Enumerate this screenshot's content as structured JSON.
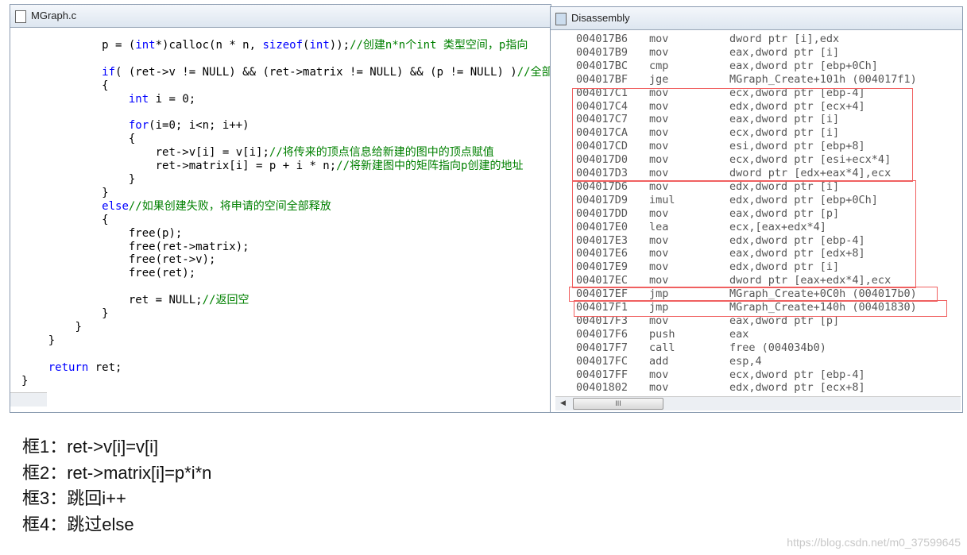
{
  "code_window": {
    "title": "MGraph.c",
    "icon": "c-file-icon",
    "lines": [
      {
        "indent": 12,
        "segs": [
          {
            "t": "p = (",
            "c": "tx"
          },
          {
            "t": "int",
            "c": "kw"
          },
          {
            "t": "*)calloc(n * n, ",
            "c": "tx"
          },
          {
            "t": "sizeof",
            "c": "kw"
          },
          {
            "t": "(",
            "c": "tx"
          },
          {
            "t": "int",
            "c": "kw"
          },
          {
            "t": "));",
            "c": "tx"
          },
          {
            "t": "//创建n*n个int 类型空间，p指向",
            "c": "cm"
          }
        ]
      },
      null,
      {
        "indent": 12,
        "segs": [
          {
            "t": "if",
            "c": "kw"
          },
          {
            "t": "( (ret->v != NULL) && (ret->matrix != NULL) && (p != NULL) )",
            "c": "tx"
          },
          {
            "t": "//全部",
            "c": "cm"
          }
        ]
      },
      {
        "indent": 12,
        "segs": [
          {
            "t": "{",
            "c": "tx"
          }
        ]
      },
      {
        "indent": 16,
        "segs": [
          {
            "t": "int",
            "c": "kw"
          },
          {
            "t": " i = 0;",
            "c": "tx"
          }
        ]
      },
      null,
      {
        "indent": 16,
        "segs": [
          {
            "t": "for",
            "c": "kw"
          },
          {
            "t": "(i=0; i<n; i++)",
            "c": "tx"
          }
        ]
      },
      {
        "indent": 16,
        "segs": [
          {
            "t": "{",
            "c": "tx"
          }
        ]
      },
      {
        "indent": 20,
        "segs": [
          {
            "t": "ret->v[i] = v[i];",
            "c": "tx"
          },
          {
            "t": "//将传来的顶点信息给新建的图中的顶点赋值",
            "c": "cm"
          }
        ]
      },
      {
        "indent": 20,
        "segs": [
          {
            "t": "ret->matrix[i] = p + i * n;",
            "c": "tx"
          },
          {
            "t": "//将新建图中的矩阵指向p创建的地址",
            "c": "cm"
          }
        ]
      },
      {
        "indent": 16,
        "segs": [
          {
            "t": "}",
            "c": "tx"
          }
        ]
      },
      {
        "indent": 12,
        "segs": [
          {
            "t": "}",
            "c": "tx"
          }
        ]
      },
      {
        "indent": 12,
        "segs": [
          {
            "t": "else",
            "c": "kw"
          },
          {
            "t": "//如果创建失败，将申请的空间全部释放",
            "c": "cm"
          }
        ]
      },
      {
        "indent": 12,
        "segs": [
          {
            "t": "{",
            "c": "tx"
          }
        ]
      },
      {
        "indent": 16,
        "segs": [
          {
            "t": "free(p);",
            "c": "tx"
          }
        ]
      },
      {
        "indent": 16,
        "segs": [
          {
            "t": "free(ret->matrix);",
            "c": "tx"
          }
        ]
      },
      {
        "indent": 16,
        "segs": [
          {
            "t": "free(ret->v);",
            "c": "tx"
          }
        ]
      },
      {
        "indent": 16,
        "segs": [
          {
            "t": "free(ret);",
            "c": "tx"
          }
        ]
      },
      null,
      {
        "indent": 16,
        "segs": [
          {
            "t": "ret = NULL;",
            "c": "tx"
          },
          {
            "t": "//返回空",
            "c": "cm"
          }
        ]
      },
      {
        "indent": 12,
        "segs": [
          {
            "t": "}",
            "c": "tx"
          }
        ]
      },
      {
        "indent": 8,
        "segs": [
          {
            "t": "}",
            "c": "tx"
          }
        ]
      },
      {
        "indent": 4,
        "segs": [
          {
            "t": "}",
            "c": "tx"
          }
        ]
      },
      null,
      {
        "indent": 4,
        "segs": [
          {
            "t": "return",
            "c": "kw"
          },
          {
            "t": " ret;",
            "c": "tx"
          }
        ]
      },
      {
        "indent": 0,
        "segs": [
          {
            "t": "}",
            "c": "tx"
          }
        ]
      }
    ]
  },
  "disasm_window": {
    "title": "Disassembly",
    "icon": "disassembly-window-icon",
    "scroll_thumb": "III",
    "rows": [
      [
        "004017B6",
        "mov",
        "dword ptr [i],edx"
      ],
      [
        "004017B9",
        "mov",
        "eax,dword ptr [i]"
      ],
      [
        "004017BC",
        "cmp",
        "eax,dword ptr [ebp+0Ch]"
      ],
      [
        "004017BF",
        "jge",
        "MGraph_Create+101h (004017f1)"
      ],
      [
        "004017C1",
        "mov",
        "ecx,dword ptr [ebp-4]"
      ],
      [
        "004017C4",
        "mov",
        "edx,dword ptr [ecx+4]"
      ],
      [
        "004017C7",
        "mov",
        "eax,dword ptr [i]"
      ],
      [
        "004017CA",
        "mov",
        "ecx,dword ptr [i]"
      ],
      [
        "004017CD",
        "mov",
        "esi,dword ptr [ebp+8]"
      ],
      [
        "004017D0",
        "mov",
        "ecx,dword ptr [esi+ecx*4]"
      ],
      [
        "004017D3",
        "mov",
        "dword ptr [edx+eax*4],ecx"
      ],
      [
        "004017D6",
        "mov",
        "edx,dword ptr [i]"
      ],
      [
        "004017D9",
        "imul",
        "edx,dword ptr [ebp+0Ch]"
      ],
      [
        "004017DD",
        "mov",
        "eax,dword ptr [p]"
      ],
      [
        "004017E0",
        "lea",
        "ecx,[eax+edx*4]"
      ],
      [
        "004017E3",
        "mov",
        "edx,dword ptr [ebp-4]"
      ],
      [
        "004017E6",
        "mov",
        "eax,dword ptr [edx+8]"
      ],
      [
        "004017E9",
        "mov",
        "edx,dword ptr [i]"
      ],
      [
        "004017EC",
        "mov",
        "dword ptr [eax+edx*4],ecx"
      ],
      [
        "004017EF",
        "jmp",
        "MGraph_Create+0C0h (004017b0)"
      ],
      [
        "004017F1",
        "jmp",
        "MGraph_Create+140h (00401830)"
      ],
      [
        "004017F3",
        "mov",
        "eax,dword ptr [p]"
      ],
      [
        "004017F6",
        "push",
        "eax"
      ],
      [
        "004017F7",
        "call",
        "free (004034b0)"
      ],
      [
        "004017FC",
        "add",
        "esp,4"
      ],
      [
        "004017FF",
        "mov",
        "ecx,dword ptr [ebp-4]"
      ],
      [
        "00401802",
        "mov",
        "edx,dword ptr [ecx+8]"
      ]
    ],
    "highlight_color": "#f06060"
  },
  "notes": [
    "框1：ret->v[i]=v[i]",
    "框2：ret->matrix[i]=p*i*n",
    "框3：跳回i++",
    "框4：跳过else"
  ],
  "watermark": "https://blog.csdn.net/m0_37599645"
}
